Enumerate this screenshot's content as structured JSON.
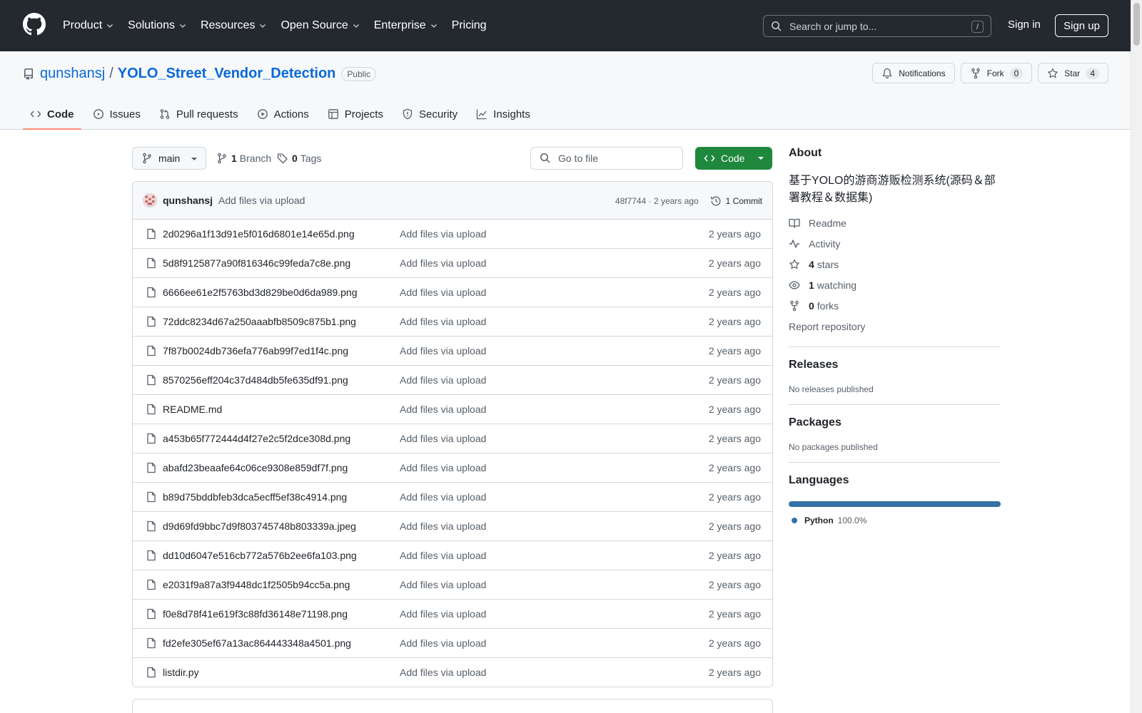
{
  "header": {
    "nav": [
      {
        "label": "Product",
        "dropdown": true
      },
      {
        "label": "Solutions",
        "dropdown": true
      },
      {
        "label": "Resources",
        "dropdown": true
      },
      {
        "label": "Open Source",
        "dropdown": true
      },
      {
        "label": "Enterprise",
        "dropdown": true
      },
      {
        "label": "Pricing",
        "dropdown": false
      }
    ],
    "search_placeholder": "Search or jump to...",
    "search_shortcut": "/",
    "sign_in": "Sign in",
    "sign_up": "Sign up"
  },
  "repo": {
    "owner": "qunshansj",
    "separator": "/",
    "name": "YOLO_Street_Vendor_Detection",
    "visibility": "Public",
    "notifications_label": "Notifications",
    "fork_label": "Fork",
    "fork_count": "0",
    "star_label": "Star",
    "star_count": "4",
    "tabs": [
      {
        "label": "Code",
        "icon": "code-icon",
        "active": true
      },
      {
        "label": "Issues",
        "icon": "issue-icon",
        "active": false
      },
      {
        "label": "Pull requests",
        "icon": "pull-request-icon",
        "active": false
      },
      {
        "label": "Actions",
        "icon": "play-icon",
        "active": false
      },
      {
        "label": "Projects",
        "icon": "table-icon",
        "active": false
      },
      {
        "label": "Security",
        "icon": "shield-icon",
        "active": false
      },
      {
        "label": "Insights",
        "icon": "graph-icon",
        "active": false
      }
    ]
  },
  "toolbar": {
    "branch": "main",
    "branch_count": "1",
    "branch_label": "Branch",
    "tag_count": "0",
    "tag_label": "Tags",
    "go_to_file": "Go to file",
    "code_button": "Code"
  },
  "commit": {
    "author": "qunshansj",
    "message": "Add files via upload",
    "hash_time": "48f7744 · 2 years ago",
    "count_label": "1 Commit"
  },
  "files": [
    {
      "name": "2d0296a1f13d91e5f016d6801e14e65d.png",
      "message": "Add files via upload",
      "time": "2 years ago"
    },
    {
      "name": "5d8f9125877a90f816346c99feda7c8e.png",
      "message": "Add files via upload",
      "time": "2 years ago"
    },
    {
      "name": "6666ee61e2f5763bd3d829be0d6da989.png",
      "message": "Add files via upload",
      "time": "2 years ago"
    },
    {
      "name": "72ddc8234d67a250aaabfb8509c875b1.png",
      "message": "Add files via upload",
      "time": "2 years ago"
    },
    {
      "name": "7f87b0024db736efa776ab99f7ed1f4c.png",
      "message": "Add files via upload",
      "time": "2 years ago"
    },
    {
      "name": "8570256eff204c37d484db5fe635df91.png",
      "message": "Add files via upload",
      "time": "2 years ago"
    },
    {
      "name": "README.md",
      "message": "Add files via upload",
      "time": "2 years ago"
    },
    {
      "name": "a453b65f772444d4f27e2c5f2dce308d.png",
      "message": "Add files via upload",
      "time": "2 years ago"
    },
    {
      "name": "abafd23beaafe64c06ce9308e859df7f.png",
      "message": "Add files via upload",
      "time": "2 years ago"
    },
    {
      "name": "b89d75bddbfeb3dca5ecff5ef38c4914.png",
      "message": "Add files via upload",
      "time": "2 years ago"
    },
    {
      "name": "d9d69fd9bbc7d9f803745748b803339a.jpeg",
      "message": "Add files via upload",
      "time": "2 years ago"
    },
    {
      "name": "dd10d6047e516cb772a576b2ee6fa103.png",
      "message": "Add files via upload",
      "time": "2 years ago"
    },
    {
      "name": "e2031f9a87a3f9448dc1f2505b94cc5a.png",
      "message": "Add files via upload",
      "time": "2 years ago"
    },
    {
      "name": "f0e8d78f41e619f3c88fd36148e71198.png",
      "message": "Add files via upload",
      "time": "2 years ago"
    },
    {
      "name": "fd2efe305ef67a13ac864443348a4501.png",
      "message": "Add files via upload",
      "time": "2 years ago"
    },
    {
      "name": "listdir.py",
      "message": "Add files via upload",
      "time": "2 years ago"
    }
  ],
  "sidebar": {
    "about_title": "About",
    "description": "基于YOLO的游商游贩检测系统(源码＆部署教程＆数据集)",
    "readme": "Readme",
    "activity": "Activity",
    "stars_count": "4",
    "stars_label": "stars",
    "watching_count": "1",
    "watching_label": "watching",
    "forks_count": "0",
    "forks_label": "forks",
    "report": "Report repository",
    "releases_title": "Releases",
    "releases_note": "No releases published",
    "packages_title": "Packages",
    "packages_note": "No packages published",
    "languages_title": "Languages",
    "languages": [
      {
        "name": "Python",
        "percent": "100.0%",
        "share": 1.0,
        "color": "#3572A5"
      }
    ]
  },
  "colors": {
    "header_bg": "#24292f",
    "link": "#0969da",
    "primary_button": "#1f883d",
    "active_tab_underline": "#fd8c73"
  }
}
